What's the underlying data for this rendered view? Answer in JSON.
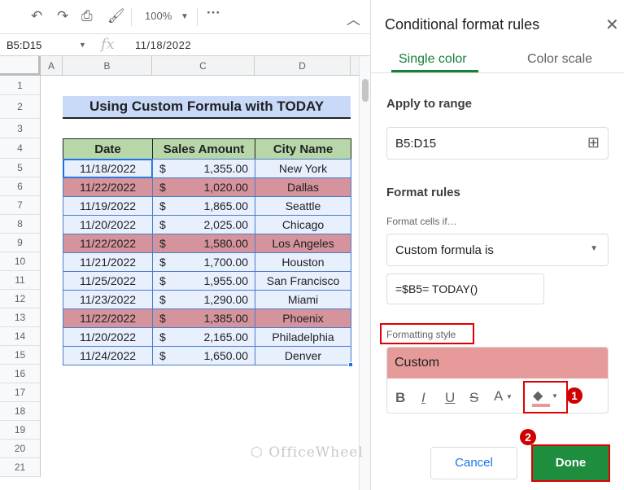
{
  "toolbar": {
    "zoom": "100%"
  },
  "formula_bar": {
    "name_box": "B5:D15",
    "fx": "fx",
    "value": "11/18/2022"
  },
  "columns": [
    "A",
    "B",
    "C",
    "D"
  ],
  "rows": [
    "1",
    "2",
    "3",
    "4",
    "5",
    "6",
    "7",
    "8",
    "9",
    "10",
    "11",
    "12",
    "13",
    "14",
    "15",
    "16",
    "17",
    "18",
    "19",
    "20",
    "21"
  ],
  "sheet": {
    "title": "Using Custom Formula with TODAY",
    "headers": [
      "Date",
      "Sales Amount",
      "City Name"
    ],
    "currency": "$",
    "data": [
      {
        "date": "11/18/2022",
        "amount": "1,355.00",
        "city": "New York",
        "hl": false
      },
      {
        "date": "11/22/2022",
        "amount": "1,020.00",
        "city": "Dallas",
        "hl": true
      },
      {
        "date": "11/19/2022",
        "amount": "1,865.00",
        "city": "Seattle",
        "hl": false
      },
      {
        "date": "11/20/2022",
        "amount": "2,025.00",
        "city": "Chicago",
        "hl": false
      },
      {
        "date": "11/22/2022",
        "amount": "1,580.00",
        "city": "Los Angeles",
        "hl": true
      },
      {
        "date": "11/21/2022",
        "amount": "1,700.00",
        "city": "Houston",
        "hl": false
      },
      {
        "date": "11/25/2022",
        "amount": "1,955.00",
        "city": "San Francisco",
        "hl": false
      },
      {
        "date": "11/23/2022",
        "amount": "1,290.00",
        "city": "Miami",
        "hl": false
      },
      {
        "date": "11/22/2022",
        "amount": "1,385.00",
        "city": "Phoenix",
        "hl": true
      },
      {
        "date": "11/20/2022",
        "amount": "2,165.00",
        "city": "Philadelphia",
        "hl": false
      },
      {
        "date": "11/24/2022",
        "amount": "1,650.00",
        "city": "Denver",
        "hl": false
      }
    ]
  },
  "watermark": "OfficeWheel",
  "panel": {
    "title": "Conditional format rules",
    "tabs": [
      "Single color",
      "Color scale"
    ],
    "apply_label": "Apply to range",
    "range": "B5:D15",
    "format_rules": "Format rules",
    "cells_if": "Format cells if…",
    "condition": "Custom formula is",
    "formula": "=$B5= TODAY()",
    "style_label": "Formatting style",
    "style_preview": "Custom",
    "style_buttons": {
      "bold": "B",
      "italic": "I",
      "underline": "U",
      "strike": "S",
      "text_color": "A"
    },
    "badges": [
      "1",
      "2"
    ],
    "cancel": "Cancel",
    "done": "Done"
  },
  "colors": {
    "highlight": "#d5939b",
    "selection": "#e8f0fe",
    "header_green": "#b7d7a8",
    "title_blue": "#c9daf8",
    "done": "#1e8e3e"
  }
}
